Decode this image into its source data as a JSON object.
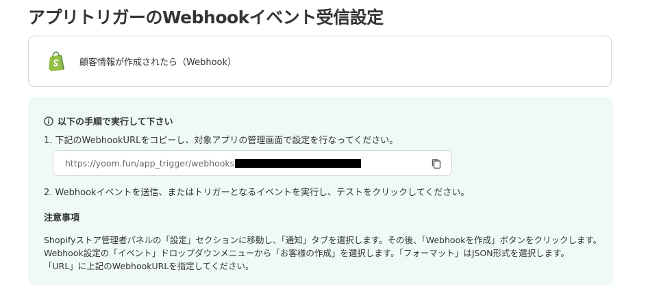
{
  "page": {
    "title": "アプリトリガーのWebhookイベント受信設定"
  },
  "trigger": {
    "app_icon": "shopify-icon",
    "label": "顧客情報が作成されたら（Webhook）"
  },
  "instructions": {
    "heading": "以下の手順で実行して下さい",
    "step1": "1. 下記のWebhookURLをコピーし、対象アプリの管理画面で設定を行なってください。",
    "webhook_url": "https://yoom.fun/app_trigger/webhooks",
    "step2": "2. Webhookイベントを送信、またはトリガーとなるイベントを実行し、テストをクリックしてください。"
  },
  "notes": {
    "heading": "注意事項",
    "lines": [
      "Shopifyストア管理者パネルの「設定」セクションに移動し、「通知」タブを選択します。その後、「Webhookを作成」ボタンをクリックします。",
      "Webhook設定の「イベント」ドロップダウンメニューから「お客様の作成」を選択します。「フォーマット」はJSON形式を選択します。",
      "「URL」に上記のWebhookURLを指定してください。"
    ]
  },
  "colors": {
    "shopify_green": "#95bf47",
    "panel_background": "#effaf7"
  }
}
